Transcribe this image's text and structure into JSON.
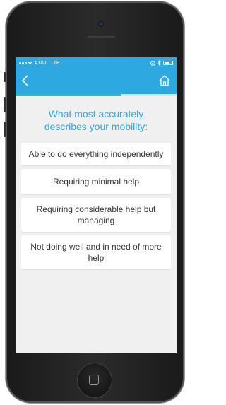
{
  "statusbar": {
    "carrier": "AT&T",
    "network": "LTE",
    "battery_level": 0.55
  },
  "navbar": {
    "back_icon": "chevron-left-icon",
    "home_icon": "home-icon"
  },
  "progress": {
    "fraction": 0.66,
    "color": "#28c986"
  },
  "question": {
    "text": "What most accurately describes your mobility:"
  },
  "options": [
    {
      "label": "Able to do everything independently"
    },
    {
      "label": "Requiring minimal help"
    },
    {
      "label": "Requiring considerable help but managing"
    },
    {
      "label": "Not doing well and in need of more help"
    }
  ],
  "colors": {
    "accent": "#2ea8e0",
    "background": "#f0f0f0",
    "card": "#ffffff"
  }
}
